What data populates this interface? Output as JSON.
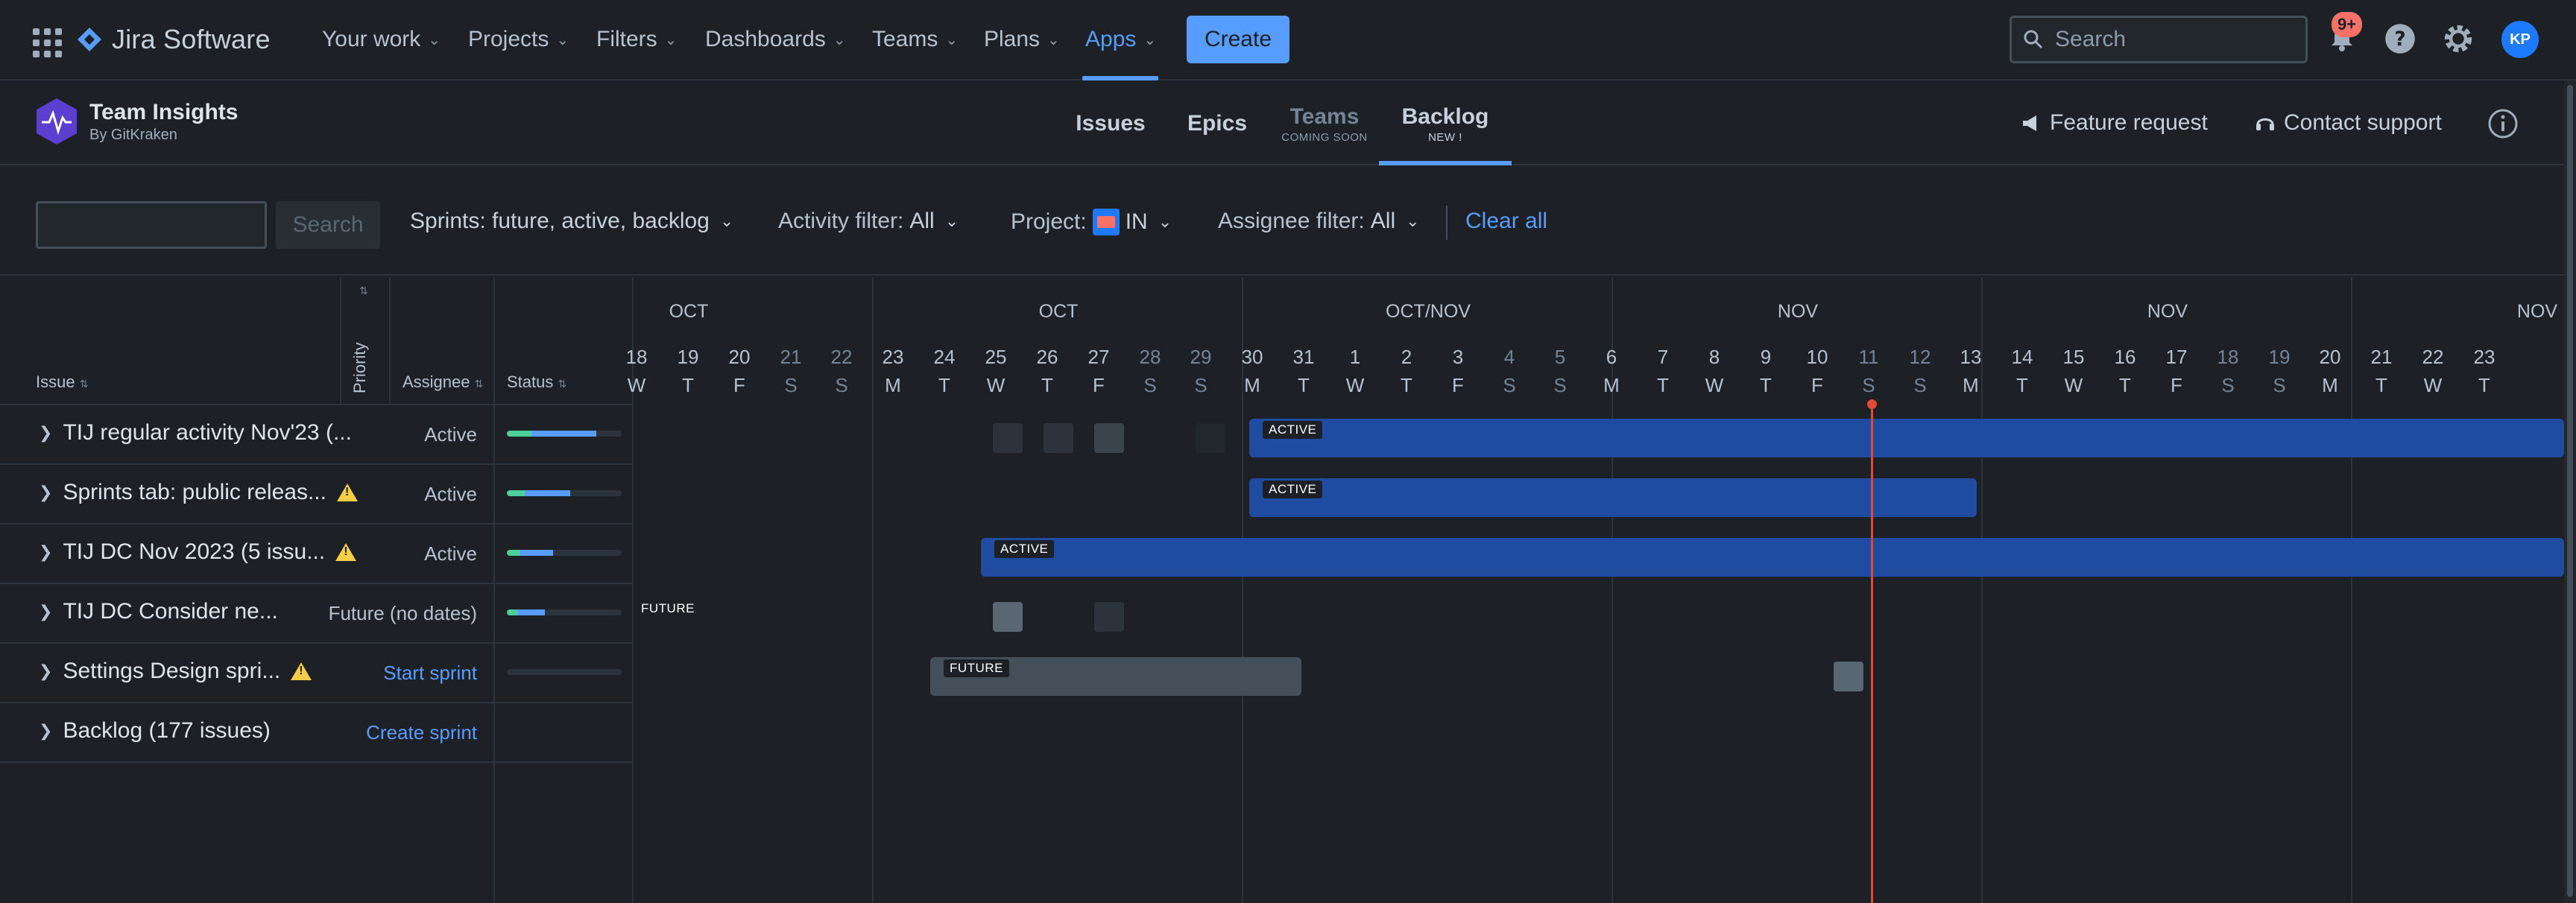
{
  "topnav": {
    "product_name": "Jira Software",
    "menus": [
      {
        "label": "Your work"
      },
      {
        "label": "Projects"
      },
      {
        "label": "Filters"
      },
      {
        "label": "Dashboards"
      },
      {
        "label": "Teams"
      },
      {
        "label": "Plans"
      },
      {
        "label": "Apps",
        "active": true
      }
    ],
    "create_label": "Create",
    "search_placeholder": "Search",
    "notifications_badge": "9+",
    "avatar_initials": "KP"
  },
  "app": {
    "name": "Team Insights",
    "by": "By GitKraken",
    "tabs": [
      {
        "label": "Issues",
        "sub": ""
      },
      {
        "label": "Epics",
        "sub": ""
      },
      {
        "label": "Teams",
        "sub": "COMING SOON"
      },
      {
        "label": "Backlog",
        "sub": "NEW !"
      }
    ],
    "feature_request": "Feature request",
    "contact_support": "Contact support"
  },
  "filters": {
    "search_button": "Search",
    "sprints": "Sprints: future, active, backlog",
    "activity_label": "Activity filter:",
    "activity_value": "All",
    "project_label": "Project:",
    "project_value": "IN",
    "assignee_label": "Assignee filter:",
    "assignee_value": "All",
    "clear_all": "Clear all"
  },
  "columns": {
    "issue": "Issue",
    "priority": "Priority",
    "assignee": "Assignee",
    "status": "Status"
  },
  "rows": [
    {
      "title": "TIJ regular activity Nov'23 (...",
      "state": "Active",
      "warning": false,
      "progress": 0.78
    },
    {
      "title": "Sprints tab: public releas...",
      "state": "Active",
      "warning": true,
      "progress": 0.55
    },
    {
      "title": "TIJ DC Nov 2023 (5 issu...",
      "state": "Active",
      "warning": true,
      "progress": 0.4
    },
    {
      "title": "TIJ DC Consider ne...",
      "state": "Future (no dates)",
      "warning": false,
      "progress": 0.33
    },
    {
      "title": "Settings Design spri...",
      "state": "Start sprint",
      "warning": true,
      "progress": 0
    },
    {
      "title": "Backlog (177 issues)",
      "state": "Create sprint",
      "warning": false,
      "progress": null
    }
  ],
  "timeline": {
    "months": [
      "OCT",
      "OCT",
      "OCT/NOV",
      "NOV",
      "NOV",
      "NOV"
    ],
    "days": [
      {
        "n": "18",
        "d": "W"
      },
      {
        "n": "19",
        "d": "T"
      },
      {
        "n": "20",
        "d": "F"
      },
      {
        "n": "21",
        "d": "S"
      },
      {
        "n": "22",
        "d": "S"
      },
      {
        "n": "23",
        "d": "M"
      },
      {
        "n": "24",
        "d": "T"
      },
      {
        "n": "25",
        "d": "W"
      },
      {
        "n": "26",
        "d": "T"
      },
      {
        "n": "27",
        "d": "F"
      },
      {
        "n": "28",
        "d": "S"
      },
      {
        "n": "29",
        "d": "S"
      },
      {
        "n": "30",
        "d": "M"
      },
      {
        "n": "31",
        "d": "T"
      },
      {
        "n": "1",
        "d": "W"
      },
      {
        "n": "2",
        "d": "T"
      },
      {
        "n": "3",
        "d": "F"
      },
      {
        "n": "4",
        "d": "S"
      },
      {
        "n": "5",
        "d": "S"
      },
      {
        "n": "6",
        "d": "M"
      },
      {
        "n": "7",
        "d": "T"
      },
      {
        "n": "8",
        "d": "W"
      },
      {
        "n": "9",
        "d": "T"
      },
      {
        "n": "10",
        "d": "F"
      },
      {
        "n": "11",
        "d": "S"
      },
      {
        "n": "12",
        "d": "S"
      },
      {
        "n": "13",
        "d": "M"
      },
      {
        "n": "14",
        "d": "T"
      },
      {
        "n": "15",
        "d": "W"
      },
      {
        "n": "16",
        "d": "T"
      },
      {
        "n": "17",
        "d": "F"
      },
      {
        "n": "18",
        "d": "S"
      },
      {
        "n": "19",
        "d": "S"
      },
      {
        "n": "20",
        "d": "M"
      },
      {
        "n": "21",
        "d": "T"
      },
      {
        "n": "22",
        "d": "W"
      },
      {
        "n": "23",
        "d": "T"
      }
    ],
    "bar_tags": {
      "active": "ACTIVE",
      "future": "FUTURE"
    }
  },
  "colors": {
    "accent": "#579dff",
    "active_bar": "#1f4ba0",
    "today": "#e34935",
    "warning": "#f5cd47"
  }
}
